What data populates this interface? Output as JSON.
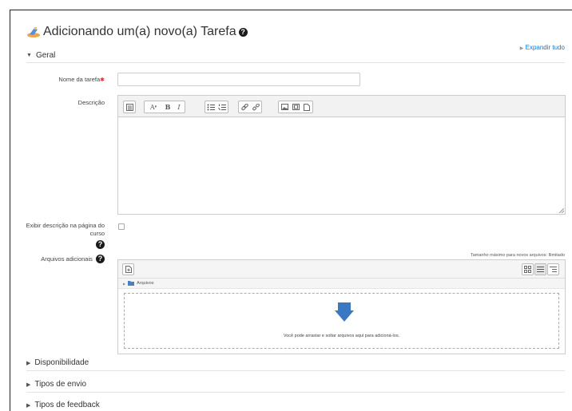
{
  "page": {
    "title": "Adicionando um(a) novo(a) Tarefa",
    "expand_all": "Expandir tudo"
  },
  "sections": {
    "general": {
      "label": "Geral",
      "expanded": true
    },
    "availability": {
      "label": "Disponibilidade",
      "expanded": false
    },
    "submission_types": {
      "label": "Tipos de envio",
      "expanded": false
    },
    "feedback_types": {
      "label": "Tipos de feedback",
      "expanded": false
    }
  },
  "form": {
    "name_label": "Nome da tarefa",
    "name_value": "",
    "description_label": "Descrição",
    "show_description_label": "Exibir descrição na página do curso",
    "show_description_checked": false,
    "additional_files_label": "Arquivos adicionais",
    "max_size_note": "Tamanho máximo para novos arquivos: Ilimitado",
    "files_folder": "Arquivos",
    "drop_hint": "Você pode arrastar e soltar arquivos aqui para adicioná-los."
  },
  "editor_toolbar": {
    "groups": [
      [
        "toolbar-toggle-icon"
      ],
      [
        "font-style-icon",
        "bold-icon",
        "italic-icon"
      ],
      [
        "unordered-list-icon",
        "ordered-list-icon"
      ],
      [
        "link-icon",
        "unlink-icon"
      ],
      [
        "image-icon",
        "media-icon",
        "file-manager-icon"
      ]
    ],
    "bold_glyph": "B",
    "italic_glyph": "I",
    "font_glyph": "A"
  },
  "colors": {
    "link": "#1177d1",
    "required": "#e0302f",
    "arrow": "#3b78c4"
  }
}
